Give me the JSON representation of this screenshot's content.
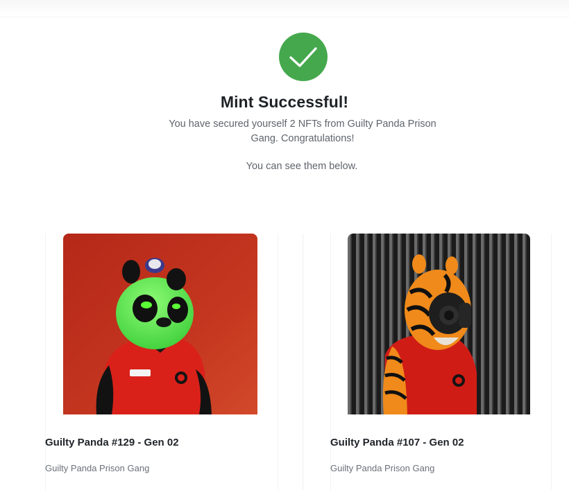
{
  "status": {
    "icon": "checkmark-icon",
    "accent_color": "#45a84d",
    "title": "Mint Successful!",
    "message": "You have secured yourself 2 NFTs from Guilty Panda Prison Gang. Congratulations!",
    "message_secondary": "You can see them below."
  },
  "nfts": [
    {
      "name": "Guilty Panda #129 - Gen 02",
      "collection": "Guilty Panda Prison Gang",
      "image": "green-panda-nft-image"
    },
    {
      "name": "Guilty Panda #107 - Gen 02",
      "collection": "Guilty Panda Prison Gang",
      "image": "tiger-panda-nft-image"
    }
  ]
}
